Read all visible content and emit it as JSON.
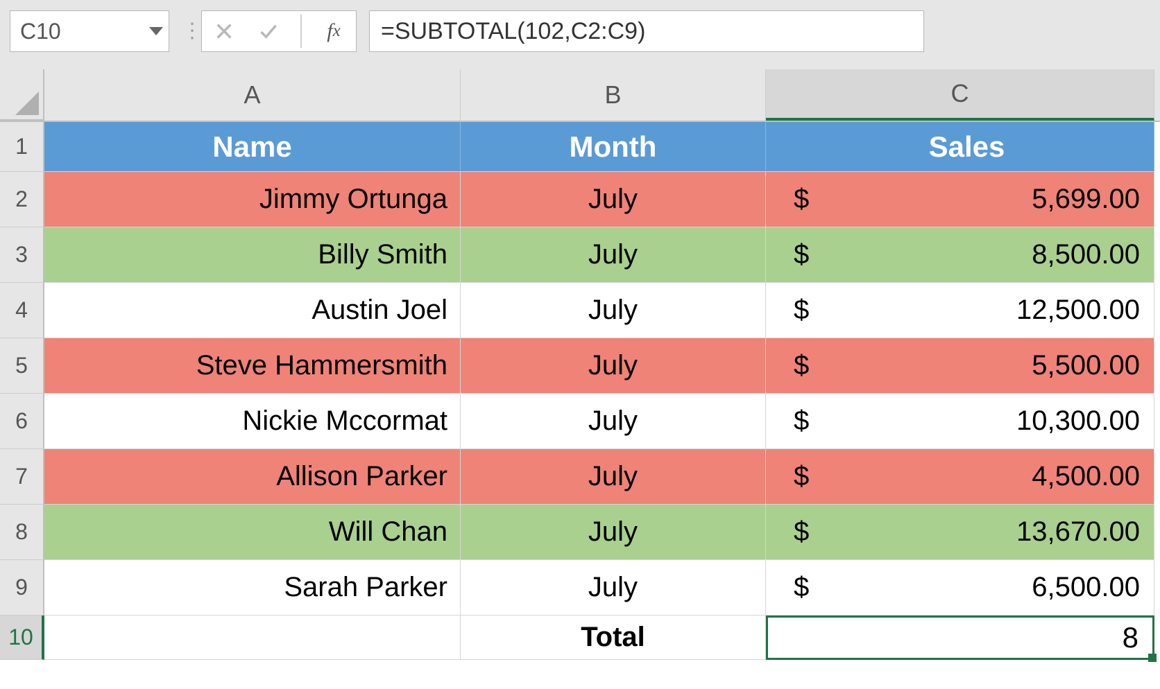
{
  "formula_bar": {
    "cell_ref": "C10",
    "formula": "=SUBTOTAL(102,C2:C9)"
  },
  "columns": [
    "A",
    "B",
    "C"
  ],
  "selected_column": "C",
  "selected_row": "10",
  "sheet": {
    "header": {
      "name": "Name",
      "month": "Month",
      "sales": "Sales"
    },
    "rows": [
      {
        "num": "2",
        "name": "Jimmy Ortunga",
        "month": "July",
        "sales_sym": "$",
        "sales": "5,699.00",
        "fill": "red"
      },
      {
        "num": "3",
        "name": "Billy Smith",
        "month": "July",
        "sales_sym": "$",
        "sales": "8,500.00",
        "fill": "green"
      },
      {
        "num": "4",
        "name": "Austin Joel",
        "month": "July",
        "sales_sym": "$",
        "sales": "12,500.00",
        "fill": "white"
      },
      {
        "num": "5",
        "name": "Steve Hammersmith",
        "month": "July",
        "sales_sym": "$",
        "sales": "5,500.00",
        "fill": "red"
      },
      {
        "num": "6",
        "name": "Nickie Mccormat",
        "month": "July",
        "sales_sym": "$",
        "sales": "10,300.00",
        "fill": "white"
      },
      {
        "num": "7",
        "name": "Allison Parker",
        "month": "July",
        "sales_sym": "$",
        "sales": "4,500.00",
        "fill": "red"
      },
      {
        "num": "8",
        "name": "Will Chan",
        "month": "July",
        "sales_sym": "$",
        "sales": "13,670.00",
        "fill": "green"
      },
      {
        "num": "9",
        "name": "Sarah Parker",
        "month": "July",
        "sales_sym": "$",
        "sales": "6,500.00",
        "fill": "white"
      }
    ],
    "total": {
      "row": "10",
      "label": "Total",
      "value": "8"
    }
  },
  "row_labels": {
    "header_row": "1"
  }
}
